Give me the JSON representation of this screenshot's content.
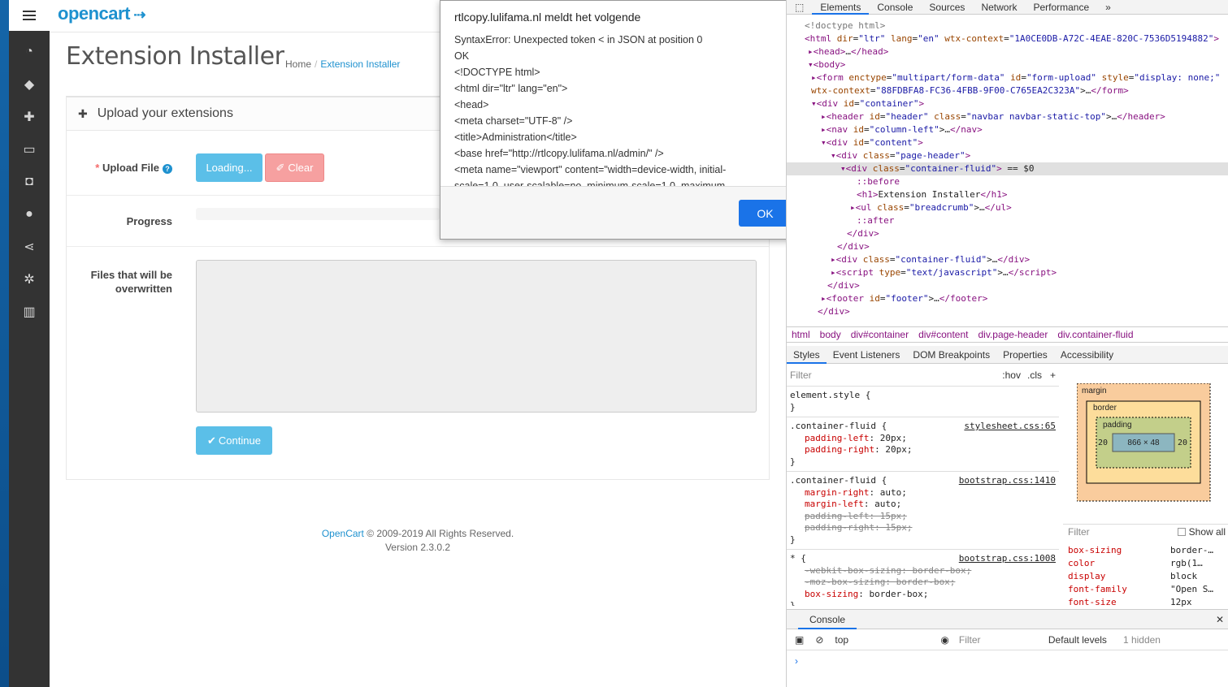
{
  "brand": "opencart",
  "sidebar": {
    "icons": [
      "dashboard-icon",
      "tags-icon",
      "puzzle-icon",
      "desktop-icon",
      "cart-icon",
      "user-icon",
      "share-icon",
      "cog-icon",
      "bar-chart-icon"
    ]
  },
  "page": {
    "title": "Extension Installer",
    "breadcrumb": [
      "Home",
      "Extension Installer"
    ]
  },
  "panel": {
    "heading": "Upload your extensions",
    "upload_label": "Upload File",
    "loading_label": "Loading...",
    "clear_label": "Clear",
    "progress_label": "Progress",
    "overwrite_label1": "Files that will be",
    "overwrite_label2": "overwritten",
    "continue_label": "Continue"
  },
  "footer": {
    "link": "OpenCart",
    "copyright": " © 2009-2019 All Rights Reserved.",
    "version": "Version 2.3.0.2"
  },
  "alert": {
    "title": "rtlcopy.lulifama.nl meldt het volgende",
    "lines": [
      "SyntaxError: Unexpected token < in JSON at position 0",
      "OK",
      "<!DOCTYPE html>",
      "<html dir=\"ltr\" lang=\"en\">",
      "<head>",
      "<meta charset=\"UTF-8\" />",
      "<title>Administration</title>",
      "<base href=\"http://rtlcopy.lulifama.nl/admin/\" />",
      "<meta name=\"viewport\" content=\"width=device-width, initial-",
      "scale=1.0, user-scalable=no, minimum-scale=1.0, maximum-"
    ],
    "ok": "OK"
  },
  "devtools": {
    "tabs": [
      "Elements",
      "Console",
      "Sources",
      "Network",
      "Performance"
    ],
    "breadcrumb": [
      "html",
      "body",
      "div#container",
      "div#content",
      "div.page-header",
      "div.container-fluid"
    ],
    "subtabs": [
      "Styles",
      "Event Listeners",
      "DOM Breakpoints",
      "Properties",
      "Accessibility"
    ],
    "filter": "Filter",
    "hov": ":hov",
    "cls": ".cls",
    "box": {
      "margin": "margin",
      "border": "border",
      "padding": "padding",
      "content": "866 × 48",
      "dash": "–",
      "pad_lr": "20"
    },
    "computed": [
      [
        "box-sizing",
        "border-…"
      ],
      [
        "color",
        "rgb(1…"
      ],
      [
        "display",
        "block"
      ],
      [
        "font-family",
        "\"Open S…"
      ],
      [
        "font-size",
        "12px"
      ]
    ],
    "show_all": "Show all",
    "console": {
      "title": "Console",
      "context": "top",
      "filter": "Filter",
      "levels": "Default levels",
      "hidden": "1 hidden"
    }
  }
}
